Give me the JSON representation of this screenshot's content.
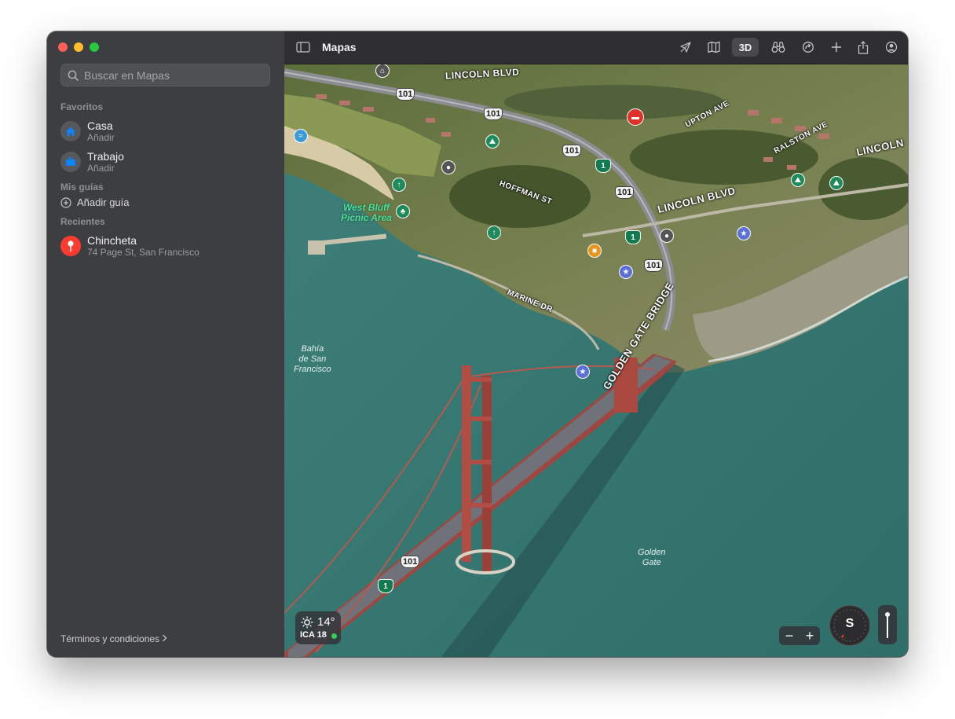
{
  "window": {
    "title": "Mapas"
  },
  "sidebar": {
    "search": {
      "placeholder": "Buscar en Mapas"
    },
    "favorites_title": "Favoritos",
    "favorites": [
      {
        "label": "Casa",
        "sub": "Añadir",
        "icon": "house-icon"
      },
      {
        "label": "Trabajo",
        "sub": "Añadir",
        "icon": "briefcase-icon"
      }
    ],
    "guides_title": "Mis guías",
    "add_guide": "Añadir guía",
    "recents_title": "Recientes",
    "recents": [
      {
        "label": "Chincheta",
        "sub": "74 Page St, San Francisco",
        "icon": "pin-icon"
      }
    ],
    "terms": "Términos y condiciones"
  },
  "toolbar": {
    "mode_3d": "3D",
    "icons": [
      "sidebar-toggle-icon",
      "location-arrow-icon",
      "map-mode-icon",
      "look-around-icon",
      "share-location-icon",
      "add-icon",
      "share-icon",
      "account-icon"
    ]
  },
  "map": {
    "streets": {
      "lincoln_top": "LINCOLN BLVD",
      "upton": "UPTON AVE",
      "ralston": "RALSTON AVE",
      "lincoln_right": "LINCOLN",
      "hoffman": "HOFFMAN ST",
      "lincoln_mid": "LINCOLN BLVD",
      "marine": "MARINE DR",
      "bridge": "GOLDEN GATE BRIDGE"
    },
    "places": {
      "picnic": "West Bluff\nPicnic Area",
      "bay": "Bahía\nde San\nFrancisco",
      "golden_gate": "Golden\nGate"
    },
    "shields": {
      "us101": "101",
      "ca1": "1"
    }
  },
  "weather": {
    "temp": "14°",
    "aqi": "ICA 18"
  },
  "controls": {
    "compass": "S",
    "zoom_out": "−",
    "zoom_in": "+"
  },
  "colors": {
    "water": "#3b7f78",
    "land": "#6e7b4c",
    "bridge": "#b5524a",
    "sidebar": "#3d3e41"
  }
}
